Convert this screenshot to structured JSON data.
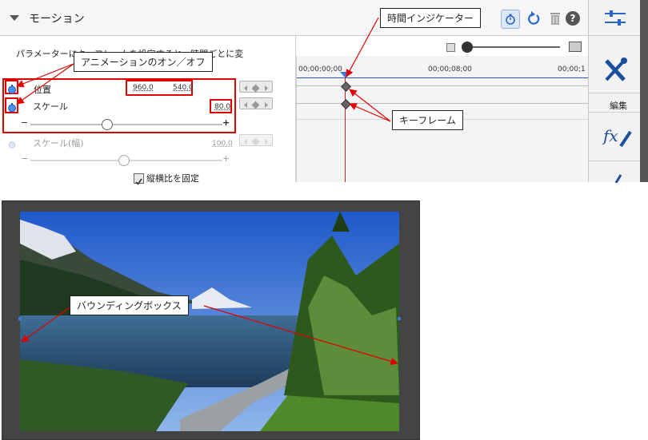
{
  "header": {
    "title": "モーション"
  },
  "left": {
    "description": "パラメーターにキーフレームを設定すると、時間ごとに変",
    "position_label": "位置",
    "position_x": "960.0",
    "position_y": "540.0",
    "scale_label": "スケール",
    "scale_value": "80.0",
    "scale_minus": "−",
    "scale_plus": "+",
    "scale_width_label": "スケール(幅)",
    "scale_width_value": "100.0",
    "sw_minus": "−",
    "sw_plus": "+",
    "checkbox_label": "縦横比を固定"
  },
  "timeline": {
    "tc0": "00;00;00;00",
    "tc1": "00;00;08;00",
    "tc2": "00;00;1"
  },
  "sidebar": {
    "edit_label": "編集"
  },
  "callouts": {
    "animation_toggle": "アニメーションのオン／オフ",
    "time_indicator": "時間インジケーター",
    "keyframe": "キーフレーム",
    "bounding_box": "バウンディングボックス"
  },
  "colors": {
    "annotation": "#e00000",
    "accent": "#1b57b7"
  }
}
